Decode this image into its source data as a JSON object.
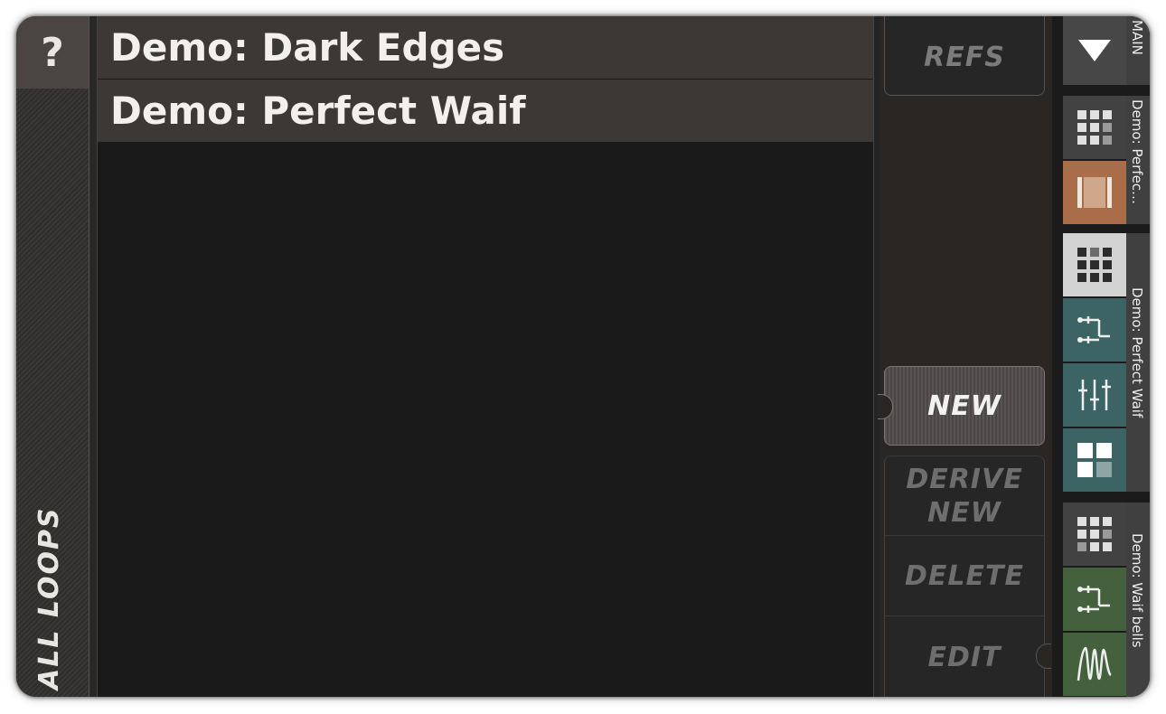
{
  "left_panel": {
    "help_label": "?",
    "section_label": "ALL LOOPS"
  },
  "list": {
    "items": [
      {
        "label": "Demo: Dark Edges"
      },
      {
        "label": "Demo: Perfect Waif"
      }
    ]
  },
  "actions": {
    "refs_label": "REFS",
    "new_label": "NEW",
    "derive_label_line1": "DERIVE",
    "derive_label_line2": "NEW",
    "delete_label": "DELETE",
    "edit_label": "EDIT"
  },
  "right_strip": {
    "main_label": "MAIN",
    "groups": [
      {
        "label": "Demo: Perfec…",
        "tiles": [
          "grid-icon",
          "frame-icon"
        ]
      },
      {
        "label": "Demo: Perfect Waif",
        "tiles": [
          "grid-icon",
          "routing-icon",
          "mixer-icon",
          "blocks-icon"
        ]
      },
      {
        "label": "Demo: Waif bells",
        "tiles": [
          "grid-icon",
          "routing-icon",
          "wave-icon"
        ]
      }
    ],
    "colors": {
      "grid_tile": "#424242",
      "grid_tile_selected": "#d2d2d2",
      "frame_tile": "#a96e49",
      "teal_tile": "#3d6464",
      "green_tile": "#45603d"
    }
  }
}
